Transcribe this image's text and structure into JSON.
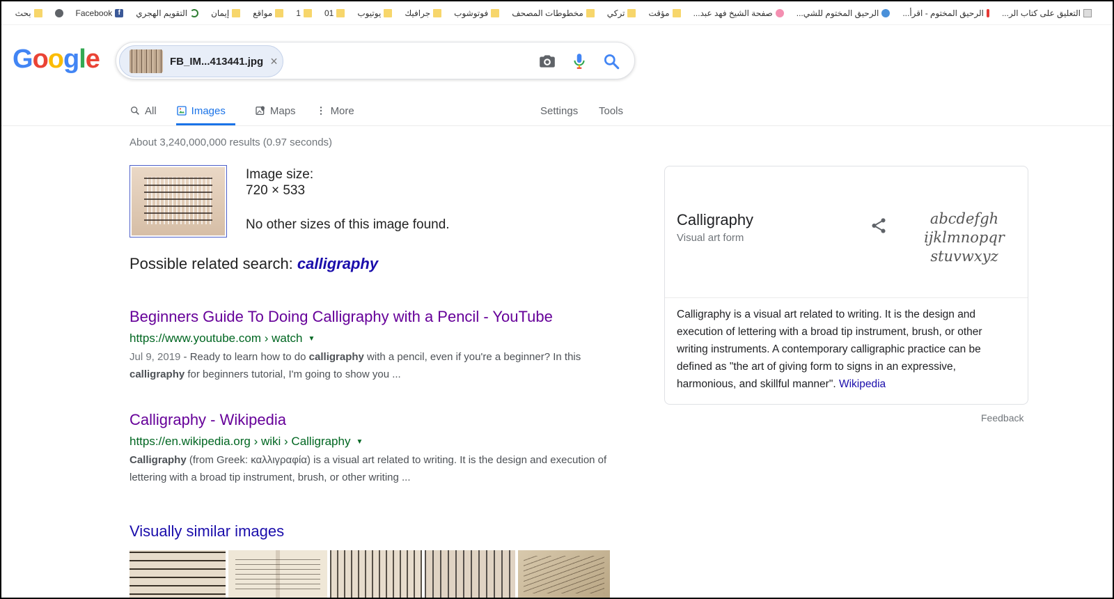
{
  "bookmarks": [
    {
      "label": "التعليق على كتاب الر...",
      "icon": "page-icon"
    },
    {
      "label": "الرحيق المختوم - اقرأ...",
      "icon": "pin-icon"
    },
    {
      "label": "الرحيق المختوم للشي...",
      "icon": "blue-circle-icon"
    },
    {
      "label": "صفحة الشيخ فهد عبد...",
      "icon": "pink-icon"
    },
    {
      "label": "مؤقت",
      "icon": "folder-icon"
    },
    {
      "label": "تركي",
      "icon": "folder-icon"
    },
    {
      "label": "مخطوطات المصحف",
      "icon": "folder-icon"
    },
    {
      "label": "فوتوشوب",
      "icon": "folder-icon"
    },
    {
      "label": "جرافيك",
      "icon": "folder-icon"
    },
    {
      "label": "يوتيوب",
      "icon": "folder-icon"
    },
    {
      "label": "01",
      "icon": "folder-icon"
    },
    {
      "label": "1",
      "icon": "folder-icon"
    },
    {
      "label": "مواقع",
      "icon": "folder-icon"
    },
    {
      "label": "إيمان",
      "icon": "folder-icon"
    },
    {
      "label": "التقويم الهجري",
      "icon": "moon-icon"
    },
    {
      "label": "Facebook",
      "icon": "facebook-icon"
    },
    {
      "label": "",
      "icon": "globe-icon"
    },
    {
      "label": "بحث",
      "icon": "folder-icon"
    }
  ],
  "logo": [
    "G",
    "o",
    "o",
    "g",
    "l",
    "e"
  ],
  "search": {
    "chip_filename": "FB_IM...413441.jpg",
    "close_glyph": "×",
    "icons": [
      "camera-icon",
      "microphone-icon",
      "search-icon"
    ]
  },
  "tabs": [
    {
      "label": "All",
      "icon": "search-icon",
      "active": false
    },
    {
      "label": "Images",
      "icon": "image-icon",
      "active": true
    },
    {
      "label": "Maps",
      "icon": "map-icon",
      "active": false
    },
    {
      "label": "More",
      "icon": "more-vert-icon",
      "active": false
    }
  ],
  "settings_label": "Settings",
  "tools_label": "Tools",
  "stats": "About 3,240,000,000 results (0.97 seconds)",
  "image_info": {
    "size_label": "Image size:",
    "size_value": "720 × 533",
    "no_other": "No other sizes of this image found.",
    "related_prefix": "Possible related search: ",
    "related_term": "calligraphy"
  },
  "results": [
    {
      "title": "Beginners Guide To Doing Calligraphy with a Pencil - YouTube",
      "url": "https://www.youtube.com › watch",
      "date": "Jul 9, 2019",
      "snippet_parts": [
        " - Ready to learn how to do ",
        "calligraphy",
        " with a pencil, even if you're a beginner? In this ",
        "calligraphy",
        " for beginners tutorial, I'm going to show you ..."
      ]
    },
    {
      "title": "Calligraphy - Wikipedia",
      "url": "https://en.wikipedia.org › wiki › Calligraphy",
      "date": "",
      "snippet_parts": [
        "",
        "Calligraphy",
        " (from Greek: καλλιγραφία) is a visual art related to writing. It is the design and execution of lettering with a broad tip instrument, brush, or other writing ..."
      ]
    }
  ],
  "visually_similar": {
    "title": "Visually similar images",
    "count": 5
  },
  "knowledge_panel": {
    "title": "Calligraphy",
    "subtitle": "Visual art form",
    "image_text": "abcdefgh ijklmnopqr stuvwxyz",
    "description": "Calligraphy is a visual art related to writing. It is the design and execution of lettering with a broad tip instrument, brush, or other writing instruments. A contemporary calligraphic practice can be defined as \"the art of giving form to signs in an expressive, harmonious, and skillful manner\". ",
    "source_link": "Wikipedia"
  },
  "feedback_label": "Feedback",
  "colors": {
    "link_visited": "#660099",
    "link": "#1a0dab",
    "url_green": "#006621",
    "accent_blue": "#1a73e8"
  }
}
